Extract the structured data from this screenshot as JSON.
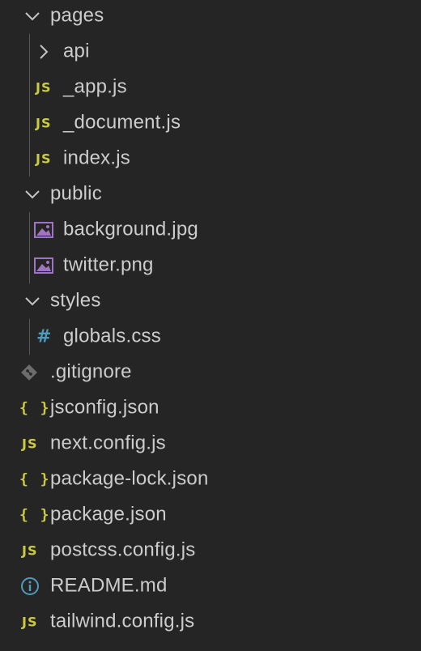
{
  "explorer": {
    "folders": {
      "pages": {
        "label": "pages",
        "state": "expanded",
        "icon": "chevron-down-icon"
      },
      "api": {
        "label": "api",
        "state": "collapsed",
        "icon": "chevron-right-icon"
      },
      "public": {
        "label": "public",
        "state": "expanded",
        "icon": "chevron-down-icon"
      },
      "styles": {
        "label": "styles",
        "state": "expanded",
        "icon": "chevron-down-icon"
      }
    },
    "files": {
      "app_js": {
        "label": "_app.js",
        "badge": "JS"
      },
      "document_js": {
        "label": "_document.js",
        "badge": "JS"
      },
      "index_js": {
        "label": "index.js",
        "badge": "JS"
      },
      "background_jpg": {
        "label": "background.jpg",
        "icon": "image-icon"
      },
      "twitter_png": {
        "label": "twitter.png",
        "icon": "image-icon"
      },
      "globals_css": {
        "label": "globals.css",
        "badge": "#"
      },
      "gitignore": {
        "label": ".gitignore",
        "icon": "git-icon"
      },
      "jsconfig_json": {
        "label": "jsconfig.json",
        "badge": "{ }"
      },
      "next_config_js": {
        "label": "next.config.js",
        "badge": "JS"
      },
      "package_lock_json": {
        "label": "package-lock.json",
        "badge": "{ }"
      },
      "package_json": {
        "label": "package.json",
        "badge": "{ }"
      },
      "postcss_config_js": {
        "label": "postcss.config.js",
        "badge": "JS"
      },
      "readme_md": {
        "label": "README.md",
        "icon": "info-icon"
      },
      "tailwind_config_js": {
        "label": "tailwind.config.js",
        "badge": "JS"
      }
    },
    "colors": {
      "background": "#252526",
      "text": "#cccccc",
      "chevron": "#c5c5c5",
      "js_badge": "#cbcb41",
      "json_badge": "#cbcb41",
      "css_badge": "#519aba",
      "image_icon": "#a074c4",
      "git_icon": "#6d6d6d",
      "info_icon": "#519aba",
      "indent_guide": "#585858"
    }
  }
}
